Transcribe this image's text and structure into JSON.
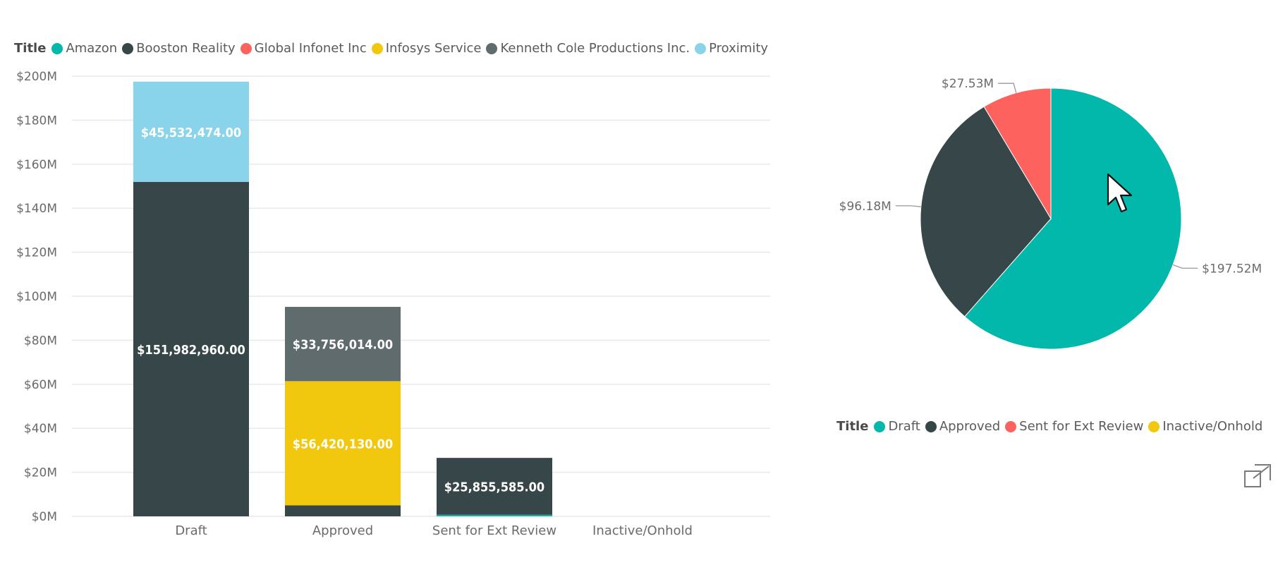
{
  "legend_bar": {
    "title": "Title",
    "items": [
      {
        "label": "Amazon",
        "color": "#01B8AA"
      },
      {
        "label": "Booston Reality",
        "color": "#374649"
      },
      {
        "label": "Global Infonet Inc",
        "color": "#FD625E"
      },
      {
        "label": "Infosys Service",
        "color": "#F2C80F"
      },
      {
        "label": "Kenneth Cole Productions Inc.",
        "color": "#5F6B6D"
      },
      {
        "label": "Proximity",
        "color": "#8AD4EB"
      }
    ]
  },
  "legend_pie": {
    "title": "Title",
    "items": [
      {
        "label": "Draft",
        "color": "#01B8AA"
      },
      {
        "label": "Approved",
        "color": "#374649"
      },
      {
        "label": "Sent for Ext Review",
        "color": "#FD625E"
      },
      {
        "label": "Inactive/Onhold",
        "color": "#F2C80F"
      }
    ]
  },
  "chart_data": [
    {
      "type": "bar",
      "stacked": true,
      "categories": [
        "Draft",
        "Approved",
        "Sent for Ext Review",
        "Inactive/Onhold"
      ],
      "yticks": [
        "$0M",
        "$20M",
        "$40M",
        "$60M",
        "$80M",
        "$100M",
        "$120M",
        "$140M",
        "$160M",
        "$180M",
        "$200M"
      ],
      "ylim": [
        0,
        200000000
      ],
      "grid": true,
      "legend_position": "top-left",
      "series": [
        {
          "name": "Amazon",
          "color": "#01B8AA",
          "values": [
            0,
            0,
            700000,
            0
          ],
          "labels": [
            "",
            "",
            "",
            ""
          ]
        },
        {
          "name": "Booston Reality",
          "color": "#374649",
          "values": [
            151982960,
            5000000,
            25855585,
            0
          ],
          "labels": [
            "$151,982,960.00",
            "",
            "$25,855,585.00",
            ""
          ]
        },
        {
          "name": "Global Infonet Inc",
          "color": "#FD625E",
          "values": [
            0,
            0,
            0,
            0
          ],
          "labels": [
            "",
            "",
            "",
            ""
          ]
        },
        {
          "name": "Infosys Service",
          "color": "#F2C80F",
          "values": [
            0,
            56420130,
            0,
            0
          ],
          "labels": [
            "",
            "$56,420,130.00",
            "",
            ""
          ]
        },
        {
          "name": "Kenneth Cole Productions Inc.",
          "color": "#5F6B6D",
          "values": [
            0,
            33756014,
            0,
            0
          ],
          "labels": [
            "",
            "$33,756,014.00",
            "",
            ""
          ]
        },
        {
          "name": "Proximity",
          "color": "#8AD4EB",
          "values": [
            45532474,
            0,
            0,
            0
          ],
          "labels": [
            "$45,532,474.00",
            "",
            "",
            ""
          ]
        }
      ]
    },
    {
      "type": "pie",
      "legend_position": "bottom",
      "slices": [
        {
          "label": "Draft",
          "value": 197.52,
          "text": "$197.52M",
          "color": "#01B8AA"
        },
        {
          "label": "Approved",
          "value": 96.18,
          "text": "$96.18M",
          "color": "#374649"
        },
        {
          "label": "Sent for Ext Review",
          "value": 27.53,
          "text": "$27.53M",
          "color": "#FD625E"
        }
      ]
    }
  ]
}
